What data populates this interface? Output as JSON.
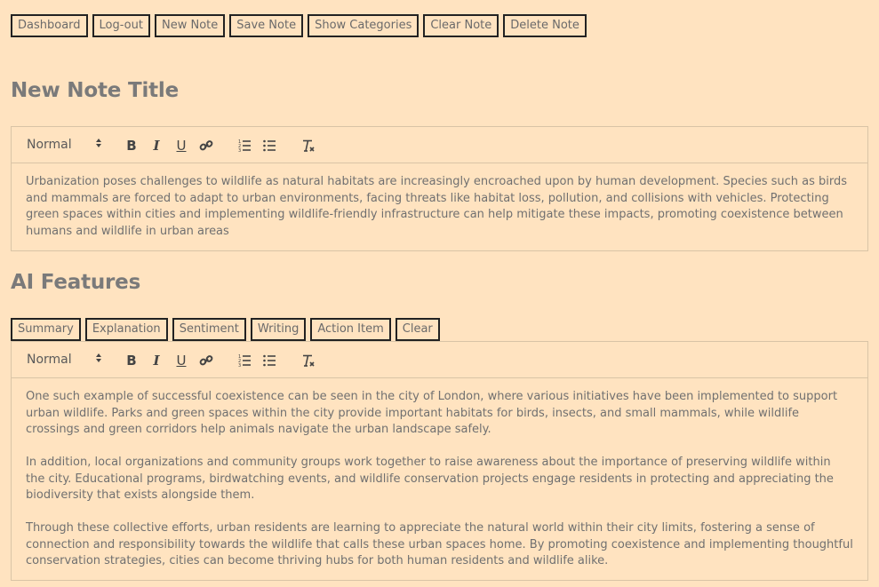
{
  "top_buttons": {
    "dashboard": "Dashboard",
    "logout": "Log-out",
    "new_note": "New Note",
    "save_note": "Save Note",
    "show_categories": "Show Categories",
    "clear_note": "Clear Note",
    "delete_note": "Delete Note"
  },
  "note": {
    "title": "New Note Title",
    "format": "Normal",
    "content": "Urbanization poses challenges to wildlife as natural habitats are increasingly encroached upon by human development. Species such as birds and mammals are forced to adapt to urban environments, facing threats like habitat loss, pollution, and collisions with vehicles. Protecting green spaces within cities and implementing wildlife-friendly infrastructure can help mitigate these impacts, promoting coexistence between humans and wildlife in urban areas"
  },
  "ai": {
    "heading": "AI Features",
    "buttons": {
      "summary": "Summary",
      "explanation": "Explanation",
      "sentiment": "Sentiment",
      "writing": "Writing",
      "action_item": "Action Item",
      "clear": "Clear"
    },
    "format": "Normal",
    "content": "One such example of successful coexistence can be seen in the city of London, where various initiatives have been implemented to support urban wildlife. Parks and green spaces within the city provide important habitats for birds, insects, and small mammals, while wildlife crossings and green corridors help animals navigate the urban landscape safely.\n\nIn addition, local organizations and community groups work together to raise awareness about the importance of preserving wildlife within the city. Educational programs, birdwatching events, and wildlife conservation projects engage residents in protecting and appreciating the biodiversity that exists alongside them.\n\nThrough these collective efforts, urban residents are learning to appreciate the natural world within their city limits, fostering a sense of connection and responsibility towards the wildlife that calls these urban spaces home. By promoting coexistence and implementing thoughtful conservation strategies, cities can become thriving hubs for both human residents and wildlife alike."
  },
  "toolbar_icons": [
    "bold-icon",
    "italic-icon",
    "underline-icon",
    "link-icon",
    "ordered-list-icon",
    "bullet-list-icon",
    "clear-format-icon"
  ],
  "colors": {
    "background": "#ffe3c0",
    "border": "#222222",
    "text": "#707070"
  }
}
